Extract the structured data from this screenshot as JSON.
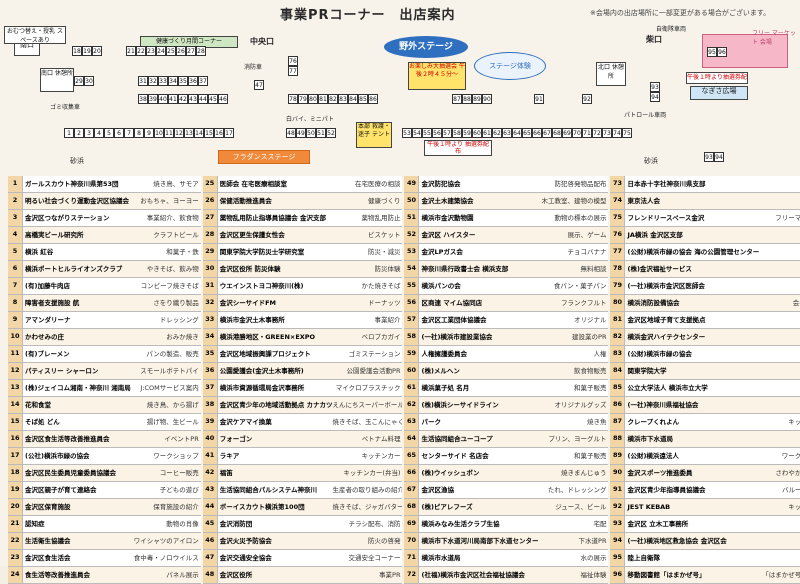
{
  "header": {
    "title": "事業PRコーナー　出店案内",
    "note": "※会場内の出店場所に一部変更がある場合がございます。"
  },
  "map": {
    "labels": {
      "minami_guchi": "南口",
      "kyuukei1": "南口\n休憩所",
      "kyuukei2": "北口\n休憩所",
      "chuuou": "中央口",
      "kita": "柴口",
      "omutsu": "おむつ替え・授乳\nスペースあり",
      "kenkou": "健康づくり月間コーナー",
      "yagai": "野外ステージ",
      "stage_taiken": "ステージ体験",
      "oyoroshimi": "お楽しみ大抽選会\n午後２時４５分～",
      "free": "フリー\nマーケット\n会場",
      "uketsuke": "受付",
      "nagisa": "なぎさ広場",
      "honbu": "本部\n救護・迷子\nテント",
      "chuusen_bottom": "午後１時より\n抽選券配布",
      "chuusen_right": "午後１時より抽選券配布",
      "flag": "フラダンスステージ",
      "sunahama1": "砂浜",
      "sunahama2": "砂浜",
      "jidousha": "自衛隊車両",
      "patrol": "パトロール車両",
      "hakushi": "白バイ、ミニパト",
      "gomi": "ゴミ収集車",
      "shoubou": "消防車"
    },
    "row_top": [
      "18",
      "19",
      "20"
    ],
    "row_kenkou": [
      "21",
      "22",
      "23",
      "24",
      "25",
      "26",
      "27",
      "28"
    ],
    "row_a": [
      "31",
      "32",
      "33",
      "34",
      "35",
      "36",
      "37"
    ],
    "row_b": [
      "38",
      "39",
      "40",
      "41",
      "42",
      "43",
      "44",
      "45",
      "46"
    ],
    "row_c": [
      "29",
      "30"
    ],
    "row_76": [
      "76",
      "77"
    ],
    "row_78": [
      "78",
      "79",
      "80",
      "81",
      "82",
      "83",
      "84",
      "85",
      "86"
    ],
    "row_87": [
      "87",
      "88",
      "89",
      "90"
    ],
    "row_91": [
      "91"
    ],
    "row_92": [
      "92"
    ],
    "row_93": [
      "93",
      "94"
    ],
    "row_95": [
      "95",
      "96"
    ],
    "row_47": [
      "47"
    ],
    "row_bottom": [
      "1",
      "2",
      "3",
      "4",
      "5",
      "6",
      "7",
      "8",
      "9",
      "10",
      "11",
      "12",
      "13",
      "14",
      "15",
      "16",
      "17"
    ],
    "row_48": [
      "48",
      "49",
      "50",
      "51",
      "52"
    ],
    "row_53": [
      "53",
      "54",
      "55",
      "56",
      "57",
      "58",
      "59",
      "60",
      "61",
      "62",
      "63",
      "64",
      "65",
      "66",
      "67",
      "68",
      "69",
      "70",
      "71",
      "72",
      "73",
      "74",
      "75"
    ],
    "row_9394": [
      "93",
      "94"
    ]
  },
  "table": {
    "col1": [
      {
        "n": "1",
        "name": "ガールスカウト神奈川県第53団",
        "item": "焼き鳥、サモア"
      },
      {
        "n": "2",
        "name": "明るい社会づくり運動金沢区協議会",
        "item": "おもちゃ、ヨーヨー"
      },
      {
        "n": "3",
        "name": "金沢区つながりステーション",
        "item": "事業紹介、飲食物"
      },
      {
        "n": "4",
        "name": "高橋実ビール研究所",
        "item": "クラフトビール"
      },
      {
        "n": "5",
        "name": "横浜 紅谷",
        "item": "和菓子・鉄"
      },
      {
        "n": "6",
        "name": "横浜ポートヒルライオンズクラブ",
        "item": "やきそば、飲み物"
      },
      {
        "n": "7",
        "name": "(有)加藤牛肉店",
        "item": "コンビーフ焼きそば"
      },
      {
        "n": "8",
        "name": "障害者支援施設 航",
        "item": "さをり織り製品"
      },
      {
        "n": "9",
        "name": "アマンダリーナ",
        "item": "ドレッシング"
      },
      {
        "n": "10",
        "name": "かわせみの庄",
        "item": "おみか焼き"
      },
      {
        "n": "11",
        "name": "(有)ブレーメン",
        "item": "パンの製造、販売"
      },
      {
        "n": "12",
        "name": "パティスリー シャーロン",
        "item": "スモールボテトパイ"
      },
      {
        "n": "13",
        "name": "(株)ジェイコム湘南・神奈川 湘南局",
        "item": "J:COMサービス案内"
      },
      {
        "n": "14",
        "name": "花和食堂",
        "item": "焼き鳥、から揚げ"
      },
      {
        "n": "15",
        "name": "そば処 どん",
        "item": "揚げ物、生ビール"
      },
      {
        "n": "16",
        "name": "金沢区食生活等改善推進員会",
        "item": "イベントPR"
      },
      {
        "n": "17",
        "name": "(公社)横浜市緑の協会",
        "item": "ワークショップ"
      },
      {
        "n": "18",
        "name": "金沢区民生委員児童委員協議会",
        "item": "コーヒー販売"
      },
      {
        "n": "19",
        "name": "金沢区親子が育て連絡会",
        "item": "子どもの遊び"
      },
      {
        "n": "20",
        "name": "金沢区保育施設",
        "item": "保育施設の紹介"
      },
      {
        "n": "21",
        "name": "認知症",
        "item": "動物の肖像"
      },
      {
        "n": "22",
        "name": "生活衛生協議会",
        "item": "ワイシャツのアイロン"
      },
      {
        "n": "23",
        "name": "金沢区食生活会",
        "item": "食中毒・ノロウイルス"
      },
      {
        "n": "24",
        "name": "食生活等改善推進員会",
        "item": "パネル展示"
      }
    ],
    "col2": [
      {
        "n": "25",
        "name": "医師会 在宅医療相談室",
        "item": "在宅医療の相談"
      },
      {
        "n": "26",
        "name": "保健活動推進員会",
        "item": "健康づくり"
      },
      {
        "n": "27",
        "name": "薬物乱用防止指導員協議会 金沢支部",
        "item": "薬物乱用防止"
      },
      {
        "n": "28",
        "name": "金沢区更生保護女性会",
        "item": "ビスケット"
      },
      {
        "n": "29",
        "name": "関東学院大学防災士学研究室",
        "item": "防災・減災"
      },
      {
        "n": "30",
        "name": "金沢区役所 防災体験",
        "item": "防災体験"
      },
      {
        "n": "31",
        "name": "ウエインストヨコ神奈川(株)",
        "item": "かた焼きそば"
      },
      {
        "n": "32",
        "name": "金沢シーサイドFM",
        "item": "ドーナッツ"
      },
      {
        "n": "33",
        "name": "横浜市金沢土木事務所",
        "item": "事業紹介"
      },
      {
        "n": "34",
        "name": "横浜港勝地区・GREEN×EXPO",
        "item": "ベロプカガイ"
      },
      {
        "n": "35",
        "name": "金沢区地域振興課プロジェクト",
        "item": "ゴミステーション"
      },
      {
        "n": "36",
        "name": "公園愛護会(金沢土木事務所)",
        "item": "公園愛護会活動PR"
      },
      {
        "n": "37",
        "name": "横浜市資源循環局金沢事務所",
        "item": "マイクロプラスチック"
      },
      {
        "n": "38",
        "name": "金沢区青少年の地域活動拠点 カナカツ",
        "item": "えんにちスーパーボール"
      },
      {
        "n": "39",
        "name": "金沢ケアマイ換菓",
        "item": "焼きそば、玉こんにゃく"
      },
      {
        "n": "40",
        "name": "フォーゴン",
        "item": "ペトナム料理"
      },
      {
        "n": "41",
        "name": "ラキア",
        "item": "キッチンカー"
      },
      {
        "n": "42",
        "name": "福笛",
        "item": "キッチンカー(弁当)"
      },
      {
        "n": "43",
        "name": "生活協同組合パルシステム神奈川",
        "item": "生産者の取り組みの紹介"
      },
      {
        "n": "44",
        "name": "ボーイスカウト横浜第100団",
        "item": "焼きそば、ジャガバター"
      },
      {
        "n": "45",
        "name": "金沢消防団",
        "item": "チラシ配布、消防"
      },
      {
        "n": "46",
        "name": "金沢火災予防協会",
        "item": "防火の啓発"
      },
      {
        "n": "47",
        "name": "金沢交通安全協会",
        "item": "交通安全コーナー"
      },
      {
        "n": "48",
        "name": "金沢区役所",
        "item": "事業PR"
      }
    ],
    "col3": [
      {
        "n": "49",
        "name": "金沢防犯協会",
        "item": "防犯啓発物品配布"
      },
      {
        "n": "50",
        "name": "金沢土木建築協会",
        "item": "木工教室、建物の模型"
      },
      {
        "n": "51",
        "name": "横浜市金沢動物園",
        "item": "動物の標本の展示"
      },
      {
        "n": "52",
        "name": "金沢区 ハイスター",
        "item": "展示、ゲーム"
      },
      {
        "n": "53",
        "name": "金沢LPガス会",
        "item": "チョコバナナ"
      },
      {
        "n": "54",
        "name": "神奈川県行政書士会 横浜支部",
        "item": "無料相談"
      },
      {
        "n": "55",
        "name": "横浜パンの会",
        "item": "食パン・菓子パン"
      },
      {
        "n": "56",
        "name": "区商連 マイム協同店",
        "item": "フランクフルト"
      },
      {
        "n": "57",
        "name": "金沢区工業団体協議会",
        "item": "オリジナル"
      },
      {
        "n": "58",
        "name": "(一社)横浜市建設業協会",
        "item": "建設業のPR"
      },
      {
        "n": "59",
        "name": "人権擁護委員会",
        "item": "人権"
      },
      {
        "n": "60",
        "name": "(株)メルヘン",
        "item": "飲食物販売"
      },
      {
        "n": "61",
        "name": "横浜菓子処 名月",
        "item": "和菓子販売"
      },
      {
        "n": "62",
        "name": "(株)横浜シーサイドライン",
        "item": "オリジナルグッズ"
      },
      {
        "n": "63",
        "name": "パーク",
        "item": "焼き魚"
      },
      {
        "n": "64",
        "name": "生活協同組合ユーコープ",
        "item": "プリン、ヨーグルト"
      },
      {
        "n": "65",
        "name": "センターサイド 名店会",
        "item": "和菓子販売"
      },
      {
        "n": "66",
        "name": "(株)ウイッシュボン",
        "item": "焼きまんじゅう"
      },
      {
        "n": "67",
        "name": "金沢区漁協",
        "item": "たれ、ドレッシング"
      },
      {
        "n": "68",
        "name": "(株)ピアレフーズ",
        "item": "ジュース、ビール"
      },
      {
        "n": "69",
        "name": "横浜みなみ生活クラブ生協",
        "item": "宅配"
      },
      {
        "n": "70",
        "name": "横浜市下水道河川局南部下水道センター",
        "item": "下水道PR"
      },
      {
        "n": "71",
        "name": "横浜市水道局",
        "item": "水の展示"
      },
      {
        "n": "72",
        "name": "(社福)横浜市金沢区社会福祉協議会",
        "item": "福祉体験"
      }
    ],
    "col4": [
      {
        "n": "73",
        "name": "日本赤十字社神奈川県支部",
        "item": "救急法"
      },
      {
        "n": "74",
        "name": "東京法人会",
        "item": "水の手帳"
      },
      {
        "n": "75",
        "name": "フレンドリースペース金沢",
        "item": "フリーマーケット"
      },
      {
        "n": "76",
        "name": "JA横浜 金沢区支部",
        "item": "野菜即売"
      },
      {
        "n": "77",
        "name": "(公財)横浜市緑の協会 海の公園管理センター",
        "item": "アマモ"
      },
      {
        "n": "78",
        "name": "(株)金沢福祉サービス",
        "item": "飲食物"
      },
      {
        "n": "79",
        "name": "(一社)横浜市金沢区医師会",
        "item": "血圧測定"
      },
      {
        "n": "80",
        "name": "横浜消防設備協会",
        "item": "会の事業PR"
      },
      {
        "n": "81",
        "name": "金沢区地域子育て支援拠点",
        "item": "遊び"
      },
      {
        "n": "82",
        "name": "横浜金沢ハイテクセンター",
        "item": "展示"
      },
      {
        "n": "83",
        "name": "(公財)横浜市緑の協会",
        "item": "PR"
      },
      {
        "n": "84",
        "name": "関東学院大学",
        "item": "やきそば"
      },
      {
        "n": "85",
        "name": "公立大学法人 横浜市立大学",
        "item": "学内紹介"
      },
      {
        "n": "86",
        "name": "(一社)神奈川県福祉協会",
        "item": "手作り品"
      },
      {
        "n": "87",
        "name": "クレープくれよん",
        "item": "キッチンカー"
      },
      {
        "n": "88",
        "name": "横浜市下水道局",
        "item": "水道PR"
      },
      {
        "n": "89",
        "name": "(公財)横浜遠法人",
        "item": "ワークショップ"
      },
      {
        "n": "90",
        "name": "金沢スポーツ推進委員",
        "item": "さわやかスポーツ"
      },
      {
        "n": "91",
        "name": "金沢区青少年指導員協議会",
        "item": "バルーンアート"
      },
      {
        "n": "92",
        "name": "JEST KEBAB",
        "item": "キッチンカー"
      },
      {
        "n": "93",
        "name": "金沢区 立木工事務所",
        "item": "事業PR"
      },
      {
        "n": "94",
        "name": "(一社)横浜地区救急協会 金沢区会",
        "item": "事業PR"
      },
      {
        "n": "95",
        "name": "陸上自衛隊",
        "item": "展示"
      },
      {
        "n": "96",
        "name": "移動図書館「はまかぜ号」",
        "item": "「はまかぜ号」の展示"
      }
    ]
  }
}
